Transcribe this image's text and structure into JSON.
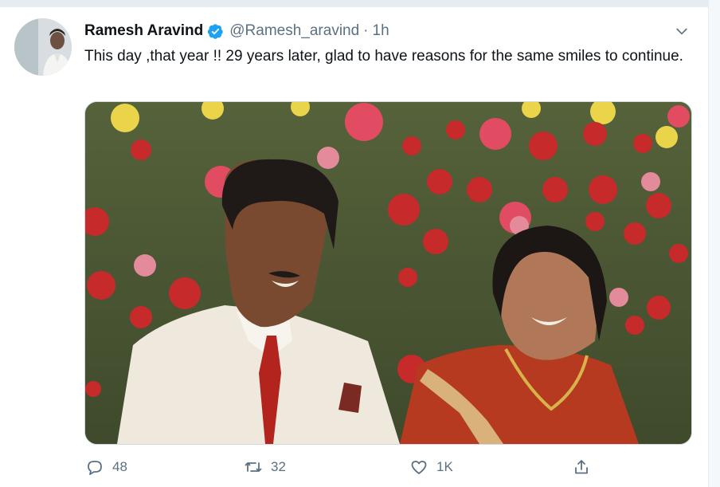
{
  "tweet": {
    "author_name": "Ramesh Aravind",
    "handle": "@Ramesh_aravind",
    "separator": "·",
    "time": "1h",
    "text": "This day ,that year !! 29 years later, glad to have reasons for the same smiles to continue."
  },
  "actions": {
    "reply_count": "48",
    "retweet_count": "32",
    "like_count": "1K"
  },
  "icons": {
    "verified": "verified-badge-icon",
    "more": "chevron-down-icon",
    "reply": "reply-icon",
    "retweet": "retweet-icon",
    "like": "heart-icon",
    "share": "share-icon"
  },
  "colors": {
    "verified": "#1da1f2",
    "muted_text": "#5b7083",
    "text": "#0f1419"
  }
}
